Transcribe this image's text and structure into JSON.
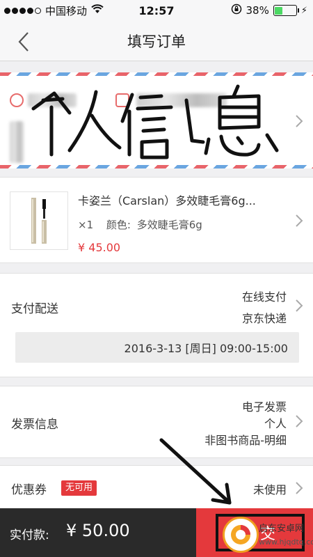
{
  "status_bar": {
    "carrier": "中国移动",
    "time": "12:57",
    "battery": "38%",
    "battery_level": 0.38
  },
  "nav": {
    "title": "填写订单"
  },
  "address": {
    "annotation": "个人信息"
  },
  "product": {
    "name": "卡姿兰（Carslan）多效睫毛膏6g...",
    "quantity": "×1",
    "spec_label": "颜色:",
    "spec_value": "多效睫毛膏6g",
    "price": "¥ 45.00"
  },
  "payment": {
    "label": "支付配送",
    "method": "在线支付",
    "courier": "京东快递",
    "delivery_time": "2016-3-13  [周日]  09:00-15:00"
  },
  "invoice": {
    "label": "发票信息",
    "type": "电子发票",
    "title": "个人",
    "content": "非图书商品-明细"
  },
  "coupon": {
    "label": "优惠券",
    "badge": "无可用",
    "status": "未使用"
  },
  "bottom": {
    "pay_label": "实付款:",
    "amount": "¥ 50.00",
    "submit_label": "提交"
  },
  "watermark": {
    "name": "启东安卓网",
    "url": "www.hjqdtq.com"
  },
  "colors": {
    "accent": "#e4393c",
    "bottom_bar": "#2a2a2a"
  }
}
